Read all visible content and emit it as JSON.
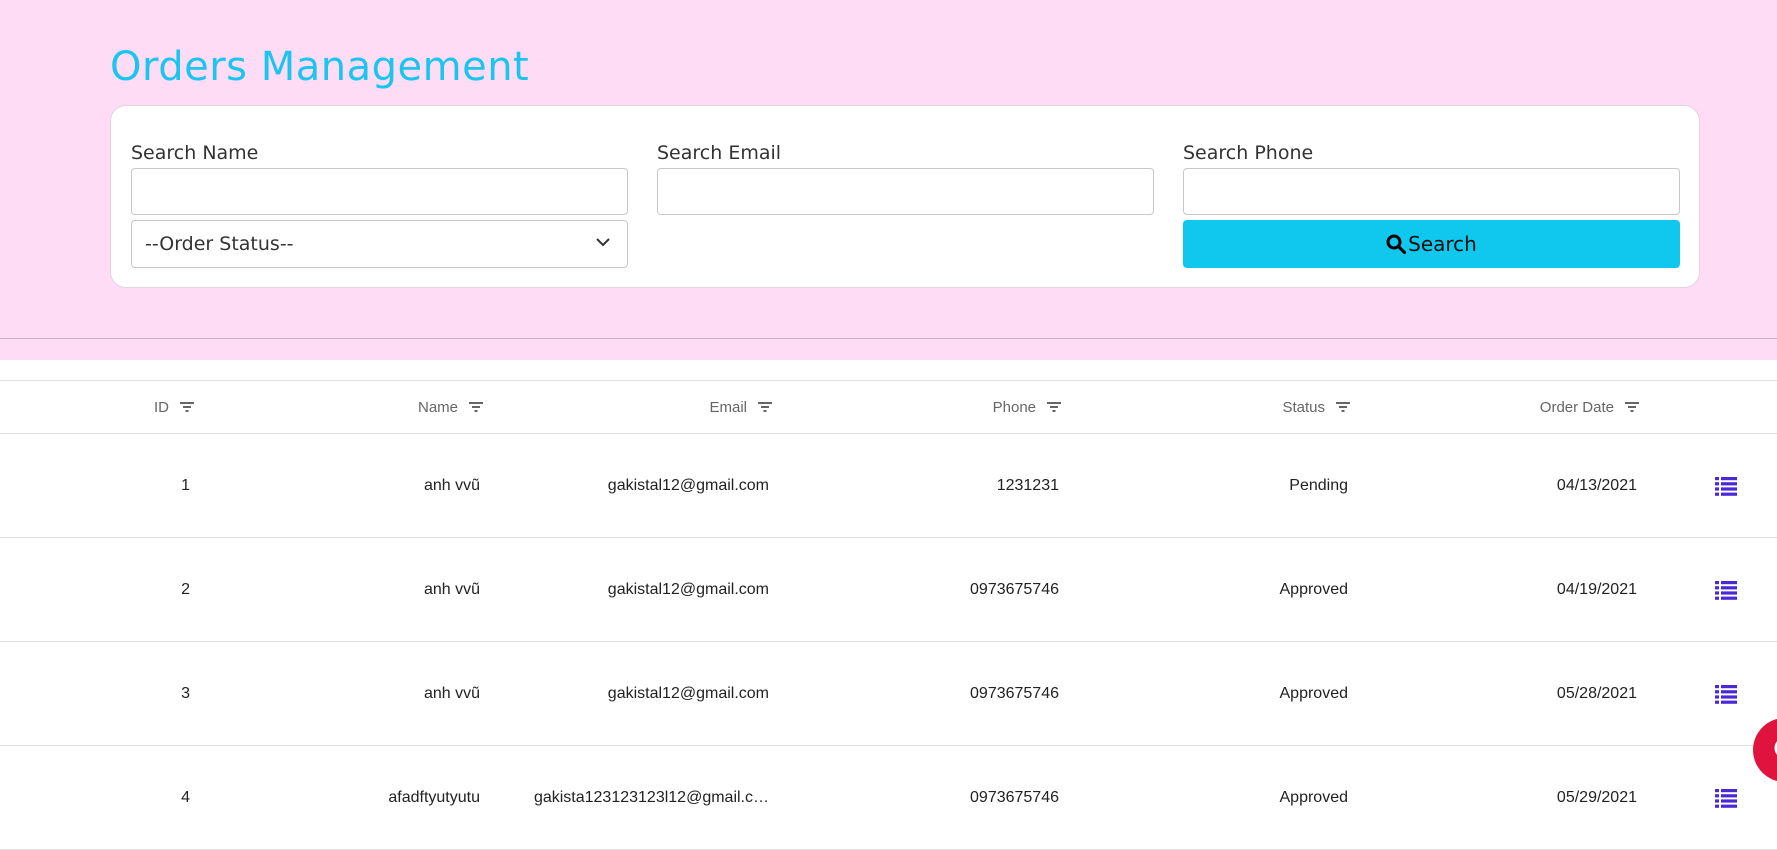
{
  "header": {
    "title": "Orders Management"
  },
  "search": {
    "name_label": "Search Name",
    "email_label": "Search Email",
    "phone_label": "Search Phone",
    "name_value": "",
    "email_value": "",
    "phone_value": "",
    "status_select": "--Order Status--",
    "button_label": "Search"
  },
  "table": {
    "columns": [
      "ID",
      "Name",
      "Email",
      "Phone",
      "Status",
      "Order Date"
    ],
    "rows": [
      {
        "id": "1",
        "name": "anh vvũ",
        "email": "gakistal12@gmail.com",
        "phone": "1231231",
        "status": "Pending",
        "date": "04/13/2021"
      },
      {
        "id": "2",
        "name": "anh vvũ",
        "email": "gakistal12@gmail.com",
        "phone": "0973675746",
        "status": "Approved",
        "date": "04/19/2021"
      },
      {
        "id": "3",
        "name": "anh vvũ",
        "email": "gakistal12@gmail.com",
        "phone": "0973675746",
        "status": "Approved",
        "date": "05/28/2021"
      },
      {
        "id": "4",
        "name": "afadftyutyutu",
        "email": "gakista123123123l12@gmail.c…",
        "phone": "0973675746",
        "status": "Approved",
        "date": "05/29/2021"
      }
    ]
  },
  "colors": {
    "accent": "#1ac6ef",
    "button": "#10c8ee",
    "header_bg": "#ffdcf5",
    "detail_icon": "#4a2ad8",
    "chat_fab": "#e0133f"
  },
  "icons": {
    "search": "search-icon",
    "filter": "filter-icon",
    "detail": "list-icon",
    "chevron": "chevron-down-icon",
    "chat": "chat-icon"
  }
}
